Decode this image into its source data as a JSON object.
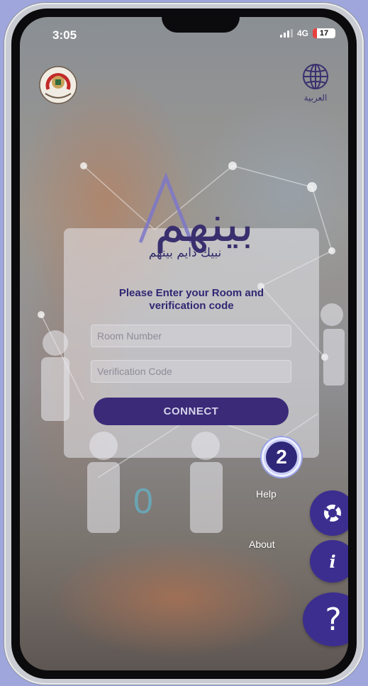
{
  "status_bar": {
    "time": "3:05",
    "network": "4G",
    "battery": "17"
  },
  "header": {
    "language_label": "العربية",
    "language_icon": "globe-icon",
    "emblem_icon": "medical-emblem-icon"
  },
  "brand": {
    "name": "بينهم",
    "tagline": "نبيك دايم بينهم",
    "color": "#3a2f6e"
  },
  "login": {
    "instruction_line1": "Please Enter your Room and",
    "instruction_line2": "verification code",
    "room_placeholder": "Room Number",
    "room_value": "",
    "verification_placeholder": "Verification Code",
    "verification_value": "",
    "connect_label": "CONNECT"
  },
  "annotation": {
    "step_number": "2"
  },
  "fab_menu": {
    "help_label": "Help",
    "about_label": "About",
    "help_icon": "lifebuoy-icon",
    "about_icon": "info-icon",
    "main_icon": "question-icon",
    "main_glyph": "?",
    "about_glyph": "i",
    "accent": "#3c2e8f"
  }
}
